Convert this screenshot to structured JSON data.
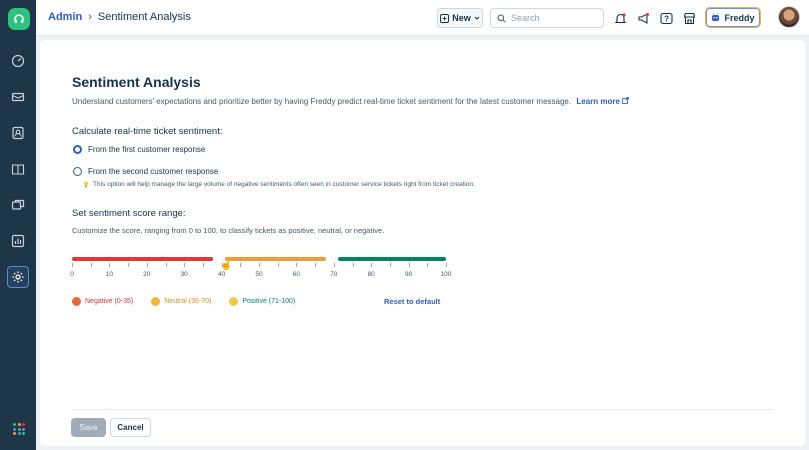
{
  "header": {
    "breadcrumb_root": "Admin",
    "breadcrumb_separator": "›",
    "breadcrumb_current": "Sentiment Analysis",
    "new_label": "New",
    "search_placeholder": "Search",
    "freddy_label": "Freddy"
  },
  "sidebar": {
    "items": [
      {
        "icon": "dashboard-icon"
      },
      {
        "icon": "tickets-icon"
      },
      {
        "icon": "contacts-icon"
      },
      {
        "icon": "solutions-icon"
      },
      {
        "icon": "forums-icon"
      },
      {
        "icon": "reports-icon"
      },
      {
        "icon": "admin-settings-icon",
        "active": true
      }
    ],
    "apps_icon": "apps-grid-icon"
  },
  "main": {
    "title": "Sentiment Analysis",
    "description": "Understand customers' expectations and prioritize better by having Freddy predict real-time ticket sentiment for the latest customer message.",
    "learn_more": "Learn more",
    "calc_title": "Calculate real-time ticket sentiment:",
    "option_first": "From the first customer response",
    "option_second": "From the second customer response",
    "selected_option": "first",
    "hint": "This option will help manage the large volume of negative sentiments often seen in customer service tickets right from ticket creation.",
    "range_title": "Set sentiment score range:",
    "range_description": "Customize the score, ranging from 0 to 100, to classify tickets as positive, neutral, or negative.",
    "slider": {
      "min": 0,
      "max": 100,
      "ticks": [
        "0",
        "10",
        "20",
        "30",
        "40",
        "50",
        "60",
        "70",
        "80",
        "90",
        "100"
      ],
      "negative_max": 35,
      "neutral_max": 70,
      "colors": {
        "negative": "#e43538",
        "neutral": "#f19c38",
        "positive": "#00875a"
      }
    },
    "legend": {
      "negative": "Negative (0-35)",
      "neutral": "Neutral (36-70)",
      "positive": "Positive (71-100)"
    },
    "reset": "Reset to default",
    "save_label": "Save",
    "cancel_label": "Cancel"
  }
}
